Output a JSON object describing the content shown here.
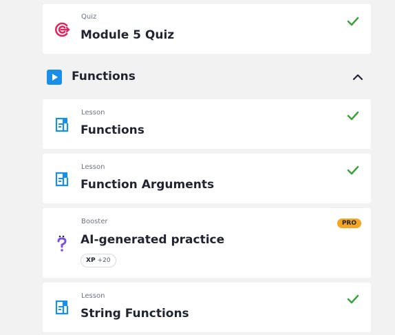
{
  "items": [
    {
      "type": "Quiz",
      "title": "Module 5 Quiz",
      "icon": "target-icon",
      "completed": true
    },
    {
      "type": "Lesson",
      "title": "Functions",
      "icon": "lesson-doc-icon",
      "completed": true
    },
    {
      "type": "Lesson",
      "title": "Function Arguments",
      "icon": "lesson-doc-icon",
      "completed": true
    },
    {
      "type": "Booster",
      "title": "AI-generated practice",
      "icon": "question-mark-icon",
      "badge": "PRO",
      "xp_label": "XP",
      "xp_value": "+20"
    },
    {
      "type": "Lesson",
      "title": "String Functions",
      "icon": "lesson-doc-icon",
      "completed": true
    }
  ],
  "section": {
    "title": "Functions",
    "icon": "play-icon",
    "collapse_icon": "chevron-up-icon"
  },
  "colors": {
    "check": "#3aa23a",
    "lesson_icon": "#1a8fe8",
    "quiz_icon": "#e0245e",
    "booster_icon": "#7b4fe0",
    "pro_badge": "#f5a623",
    "section_icon": "#1a8fe8"
  }
}
